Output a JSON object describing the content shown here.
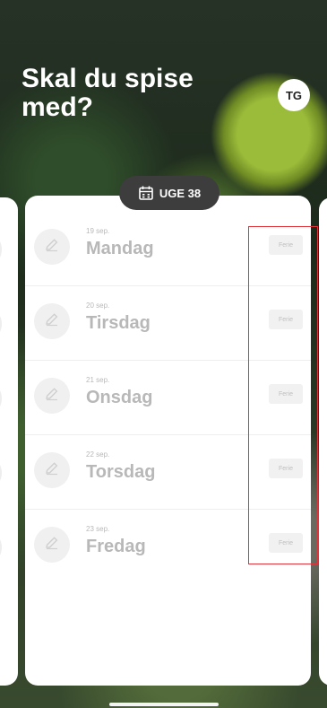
{
  "header": {
    "title": "Skal du spise med?",
    "avatar_initials": "TG"
  },
  "week": {
    "label": "UGE 38"
  },
  "days": [
    {
      "date": "19 sep.",
      "name": "Mandag",
      "status": "Ferie"
    },
    {
      "date": "20 sep.",
      "name": "Tirsdag",
      "status": "Ferie"
    },
    {
      "date": "21 sep.",
      "name": "Onsdag",
      "status": "Ferie"
    },
    {
      "date": "22 sep.",
      "name": "Torsdag",
      "status": "Ferie"
    },
    {
      "date": "23 sep.",
      "name": "Fredag",
      "status": "Ferie"
    }
  ],
  "colors": {
    "pill_bg": "#3d3d3d",
    "highlight": "#e0343a",
    "muted_text": "#b8b8b8"
  },
  "icons": {
    "edit": "pencil-icon",
    "calendar": "calendar-icon"
  }
}
